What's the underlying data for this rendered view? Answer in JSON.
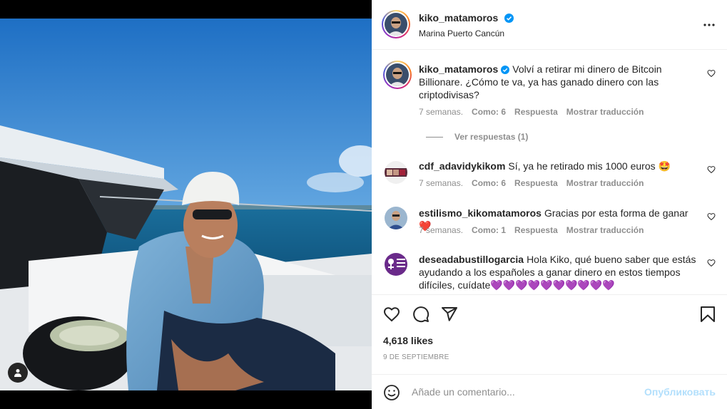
{
  "post": {
    "author": "kiko_matamoros",
    "location": "Marina Puerto Cancún",
    "verified": true
  },
  "icons": {
    "more": "more-icon",
    "tag": "user-tag-icon",
    "verified": "verified-badge-icon",
    "heart": "heart-icon",
    "comment": "comment-icon",
    "share": "share-icon",
    "save": "bookmark-icon",
    "emoji": "emoji-icon"
  },
  "comments": [
    {
      "username": "kiko_matamoros",
      "verified": true,
      "text": "Volví a retirar mi dinero de Bitcoin Billionare. ¿Cómo te va, ya has ganado dinero con las criptodivisas?",
      "time": "7 semanas.",
      "likes": "Como: 6",
      "reply": "Respuesta",
      "translate": "Mostrar traducción",
      "view_replies": "Ver respuestas (1)"
    },
    {
      "username": "cdf_adavidykikom",
      "text": "Sí, ya he retirado mis 1000 euros 🤩",
      "time": "7 semanas.",
      "likes": "Como: 6",
      "reply": "Respuesta",
      "translate": "Mostrar traducción"
    },
    {
      "username": "estilismo_kikomatamoros",
      "text": "Gracias por esta forma de ganar❤️",
      "time": "7 semanas.",
      "likes": "Como: 1",
      "reply": "Respuesta",
      "translate": "Mostrar traducción"
    },
    {
      "username": "deseadabustillogarcia",
      "text": "Hola Kiko, qué bueno saber que estás ayudando a los españoles a ganar dinero en estos tiempos difíciles, cuídate💜💜💜💜💜💜💜💜💜💜"
    }
  ],
  "stats": {
    "likes": "4,618 likes",
    "date": "9 de septiembre"
  },
  "composer": {
    "placeholder": "Añade un comentario...",
    "publish": "Опубликовать"
  },
  "colors": {
    "accent": "#0095f6",
    "verified": "#0095f6",
    "muted": "#8e8e8e",
    "publish_disabled": "#b2dffc"
  }
}
